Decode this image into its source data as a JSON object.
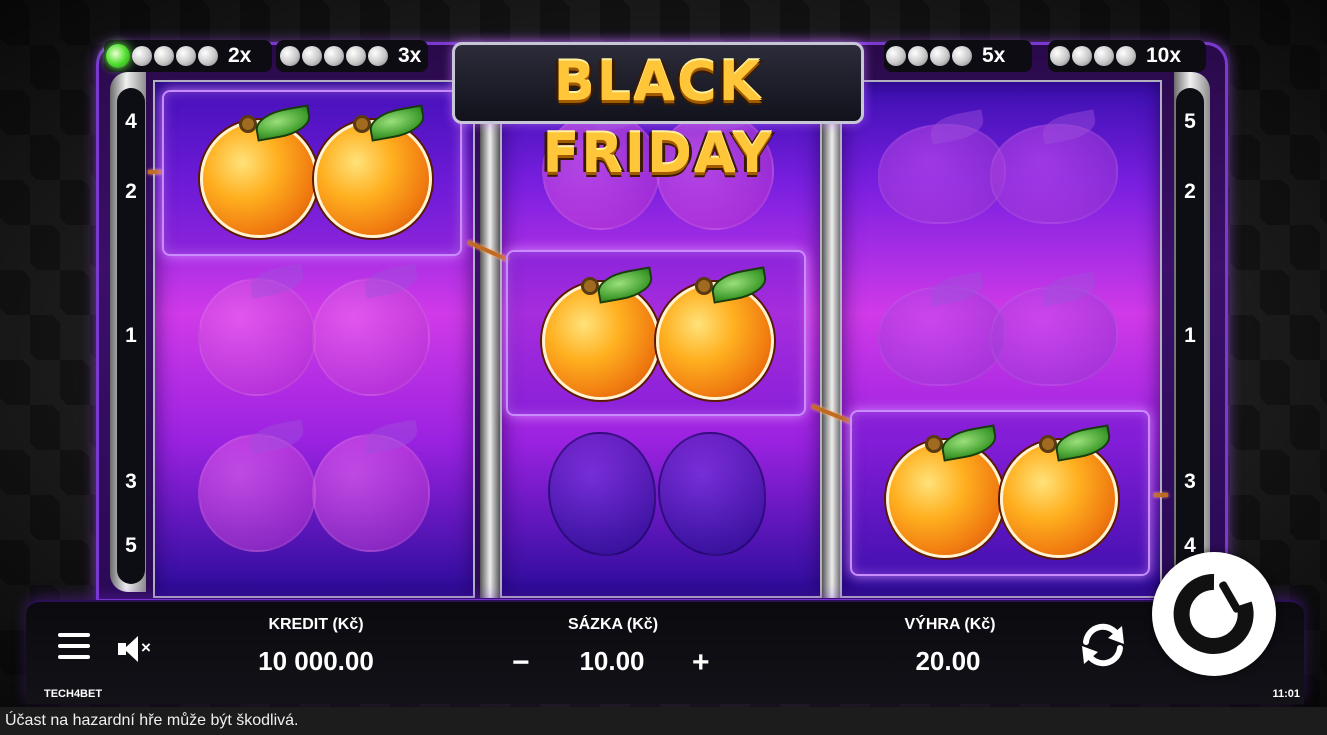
{
  "title": "BLACK FRIDAY",
  "multipliers": [
    {
      "label": "2x",
      "pearls": 5,
      "active": 1
    },
    {
      "label": "3x",
      "pearls": 5,
      "active": 0
    },
    {
      "label": "5x",
      "pearls": 4,
      "active": 0
    },
    {
      "label": "10x",
      "pearls": 4,
      "active": 0
    }
  ],
  "paylines": {
    "left": [
      "4",
      "2",
      "1",
      "3",
      "5"
    ],
    "right": [
      "5",
      "2",
      "1",
      "3",
      "4"
    ]
  },
  "reels": [
    [
      "orange",
      "dim-orange",
      "dim-orange"
    ],
    [
      "dim-orange",
      "orange",
      "dim-plum"
    ],
    [
      "dim-lemon",
      "dim-lemon",
      "orange"
    ]
  ],
  "winning_symbol": "orange",
  "stats": {
    "credit_label": "KREDIT (Kč)",
    "credit_value": "10 000.00",
    "bet_label": "SÁZKA (Kč)",
    "bet_value": "10.00",
    "bet_minus": "−",
    "bet_plus": "+",
    "win_label": "VÝHRA (Kč)",
    "win_value": "20.00"
  },
  "icons": {
    "menu": "hamburger-icon",
    "sound": "sound-muted-icon",
    "autoplay": "autoplay-icon",
    "spin": "spin-icon"
  },
  "brand": "TECH4BET",
  "clock": "11:01",
  "disclaimer": "Účast na hazardní hře může být škodlivá.",
  "colors": {
    "accent_purple": "#7a1fe0",
    "highlight_pink": "#d03ae8",
    "active_pearl": "#54e034",
    "logo_gold": "#ffc63a"
  }
}
